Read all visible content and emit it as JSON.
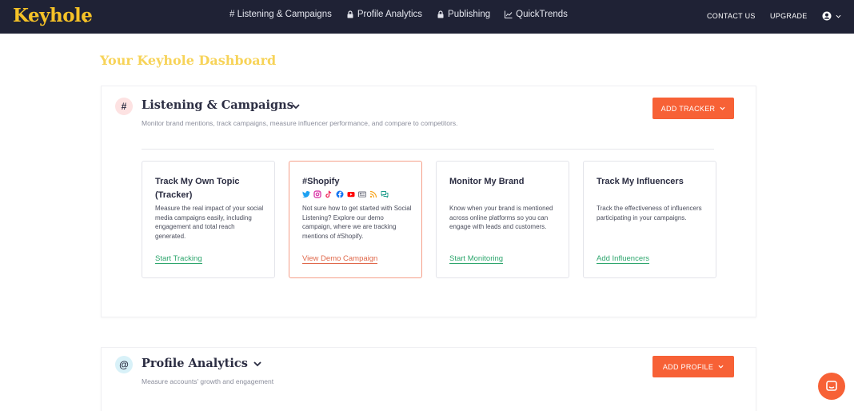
{
  "brand": {
    "logo": "Keyhole",
    "accent": "#f5c227"
  },
  "nav": {
    "items": [
      {
        "label": "# Listening & Campaigns",
        "icon": ""
      },
      {
        "label": "Profile Analytics",
        "icon": "lock-icon"
      },
      {
        "label": "Publishing",
        "icon": "lock-icon"
      },
      {
        "label": "QuickTrends",
        "icon": "trend-chart-icon"
      }
    ],
    "contact": "CONTACT US",
    "upgrade": "UPGRADE"
  },
  "page": {
    "title": "Your Keyhole Dashboard"
  },
  "listening": {
    "icon": "#",
    "title": "Listening & Campaigns",
    "description": "Monitor brand mentions, track campaigns, measure influencer performance, and compare to competitors.",
    "button": "ADD TRACKER",
    "cards": [
      {
        "title": "Track My Own Topic (Tracker)",
        "description": "Measure the real impact of your social media campaigns easily, including engagement and total reach generated.",
        "link": "Start Tracking"
      },
      {
        "title": "#Shopify",
        "description": "Not sure how to get started with Social Listening? Explore our demo campaign, where we are tracking mentions of #Shopify.",
        "link": "View Demo Campaign"
      },
      {
        "title": "Monitor My Brand",
        "description": "Know when your brand is mentioned across online platforms so you can engage with leads and customers.",
        "link": "Start Monitoring"
      },
      {
        "title": "Track My Influencers",
        "description": "Track the effectiveness of influencers participating in your campaigns.",
        "link": "Add Influencers"
      }
    ]
  },
  "profile": {
    "icon": "@",
    "title": "Profile Analytics",
    "description": "Measure accounts' growth and engagement",
    "button": "ADD PROFILE"
  },
  "colors": {
    "nav_bg": "#1f2235",
    "button": "#f76136",
    "link": "#2da66d",
    "title": "#f7d358"
  }
}
